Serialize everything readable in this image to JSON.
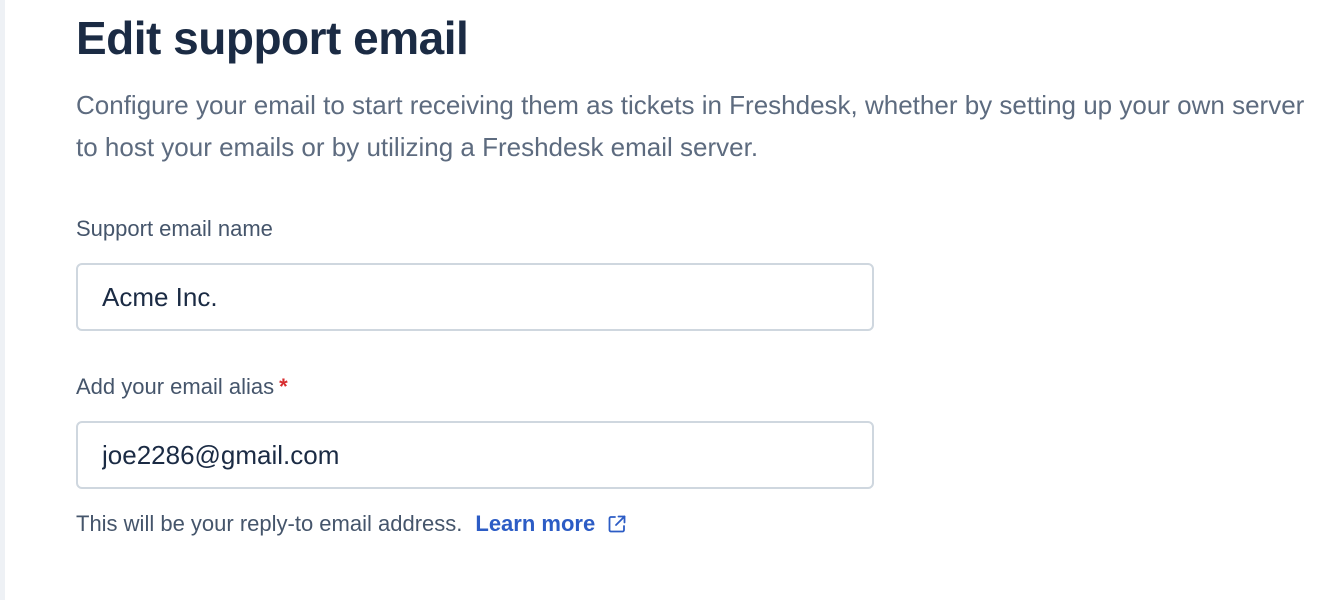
{
  "page": {
    "title": "Edit support email",
    "description": "Configure your email to start receiving them as tickets in Freshdesk, whether by setting up your own server to host your emails or by utilizing a Freshdesk email server."
  },
  "form": {
    "support_email_name": {
      "label": "Support email name",
      "value": "Acme Inc."
    },
    "email_alias": {
      "label": "Add your email alias",
      "required_marker": "*",
      "value": "joe2286@gmail.com",
      "helper_text": "This will be your reply-to email address.",
      "learn_more_label": "Learn more",
      "learn_more_icon": "external-link-icon"
    }
  },
  "colors": {
    "title": "#1b2b44",
    "link": "#2c5cc5",
    "required": "#d72d30",
    "input_border": "#cfd7df"
  }
}
